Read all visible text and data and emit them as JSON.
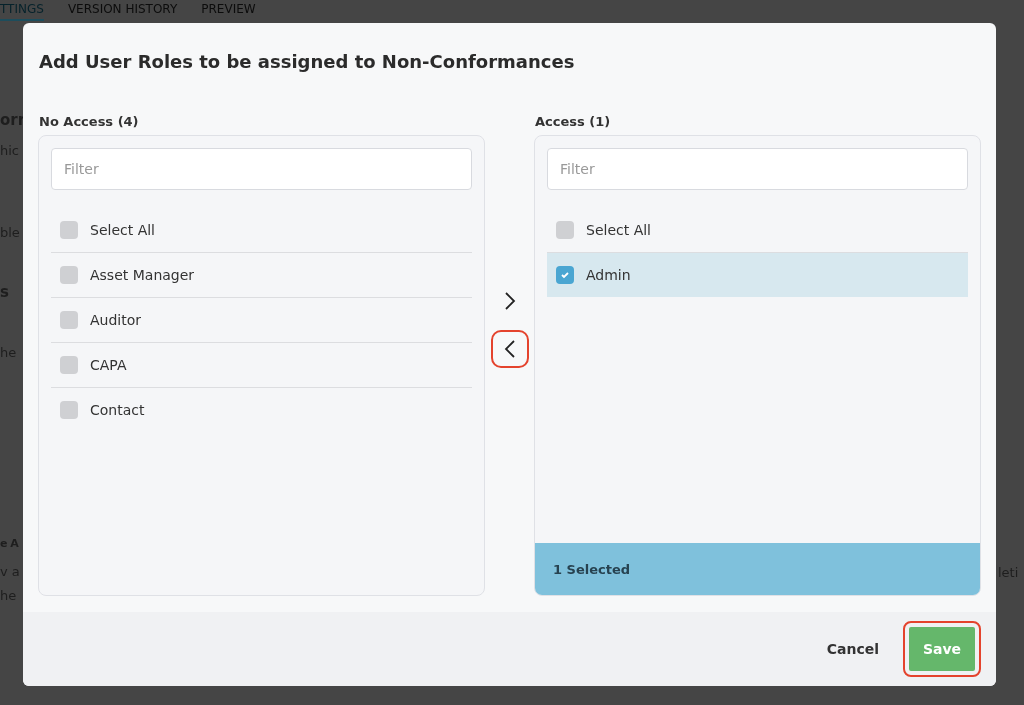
{
  "background": {
    "tabs": [
      {
        "label": "TTINGS",
        "selected": true
      },
      {
        "label": "VERSION HISTORY",
        "selected": false
      },
      {
        "label": "PREVIEW",
        "selected": false
      }
    ],
    "left_fragments": [
      {
        "text": "orr",
        "kind": "heading"
      },
      {
        "text": "hic",
        "kind": "text"
      },
      {
        "text": "ble",
        "kind": "text"
      },
      {
        "text": "s",
        "kind": "heading"
      },
      {
        "text": "he",
        "kind": "text"
      },
      {
        "text": "e A",
        "kind": "heading"
      },
      {
        "text": "v a",
        "kind": "text"
      },
      {
        "text": "he",
        "kind": "text"
      }
    ],
    "right_fragment": "leti"
  },
  "dialog": {
    "title": "Add User Roles to be assigned to Non-Conformances",
    "lists": [
      {
        "label": "No Access (4)",
        "filter_placeholder": "Filter",
        "select_all": {
          "label": "Select All",
          "checked": false
        },
        "items": [
          {
            "label": "Asset Manager",
            "checked": false
          },
          {
            "label": "Auditor",
            "checked": false
          },
          {
            "label": "CAPA",
            "checked": false
          },
          {
            "label": "Contact",
            "checked": false
          }
        ]
      },
      {
        "label": "Access (1)",
        "filter_placeholder": "Filter",
        "select_all": {
          "label": "Select All",
          "checked": false
        },
        "items": [
          {
            "label": "Admin",
            "checked": true
          }
        ],
        "footer": "1 Selected"
      }
    ],
    "move_buttons": [
      {
        "kind": "right",
        "highlighted": false
      },
      {
        "kind": "left",
        "highlighted": true
      }
    ],
    "buttons": [
      {
        "label": "Cancel",
        "kind": "text",
        "highlighted": false
      },
      {
        "label": "Save",
        "kind": "primary",
        "highlighted": true
      }
    ]
  }
}
